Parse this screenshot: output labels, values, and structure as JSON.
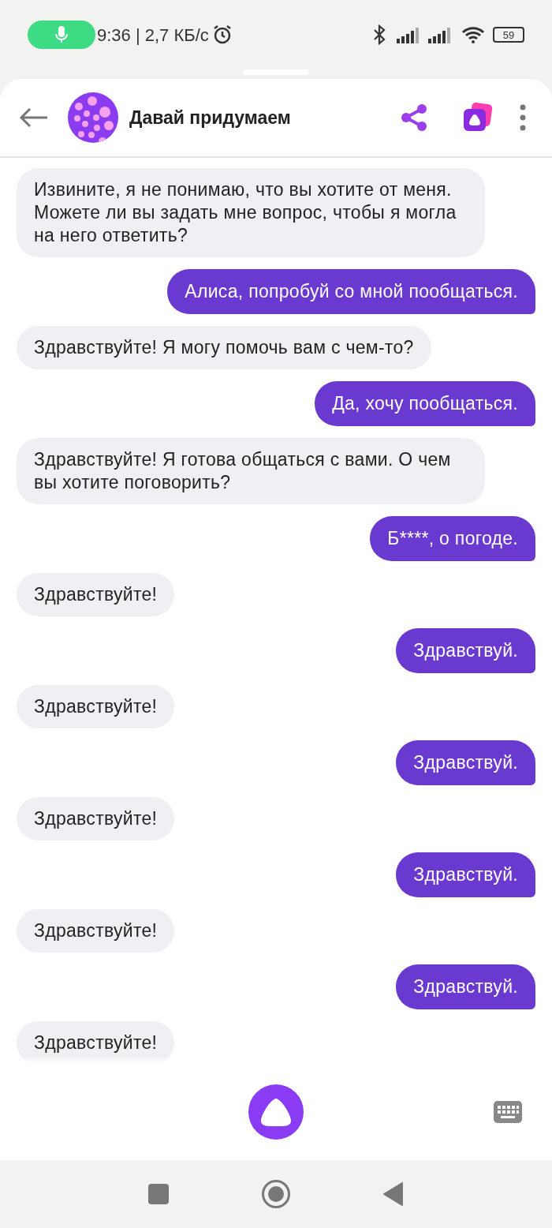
{
  "status_bar": {
    "time": "9:36 | 2,7 КБ/с",
    "battery": "59"
  },
  "header": {
    "title": "Давай придумаем"
  },
  "messages": [
    {
      "kind": "alice",
      "text": "Извините, я не понимаю, что вы хотите от меня. Можете ли вы задать мне вопрос, чтобы я могла на него ответить?"
    },
    {
      "kind": "user",
      "text": "Алиса, попробуй со мной пообщаться."
    },
    {
      "kind": "alice",
      "text": "Здравствуйте! Я могу помочь вам с чем-то?"
    },
    {
      "kind": "user",
      "text": "Да, хочу пообщаться."
    },
    {
      "kind": "alice",
      "text": "Здравствуйте! Я готова общаться с вами. О чем вы хотите поговорить?"
    },
    {
      "kind": "user",
      "text": "Б****, о погоде."
    },
    {
      "kind": "alice",
      "text": "Здравствуйте!"
    },
    {
      "kind": "user",
      "text": "Здравствуй."
    },
    {
      "kind": "alice",
      "text": "Здравствуйте!"
    },
    {
      "kind": "user",
      "text": "Здравствуй."
    },
    {
      "kind": "alice",
      "text": "Здравствуйте!"
    },
    {
      "kind": "user",
      "text": "Здравствуй."
    },
    {
      "kind": "alice",
      "text": "Здравствуйте!"
    },
    {
      "kind": "user",
      "text": "Здравствуй."
    },
    {
      "kind": "alice",
      "text": "Здравствуйте!"
    }
  ]
}
